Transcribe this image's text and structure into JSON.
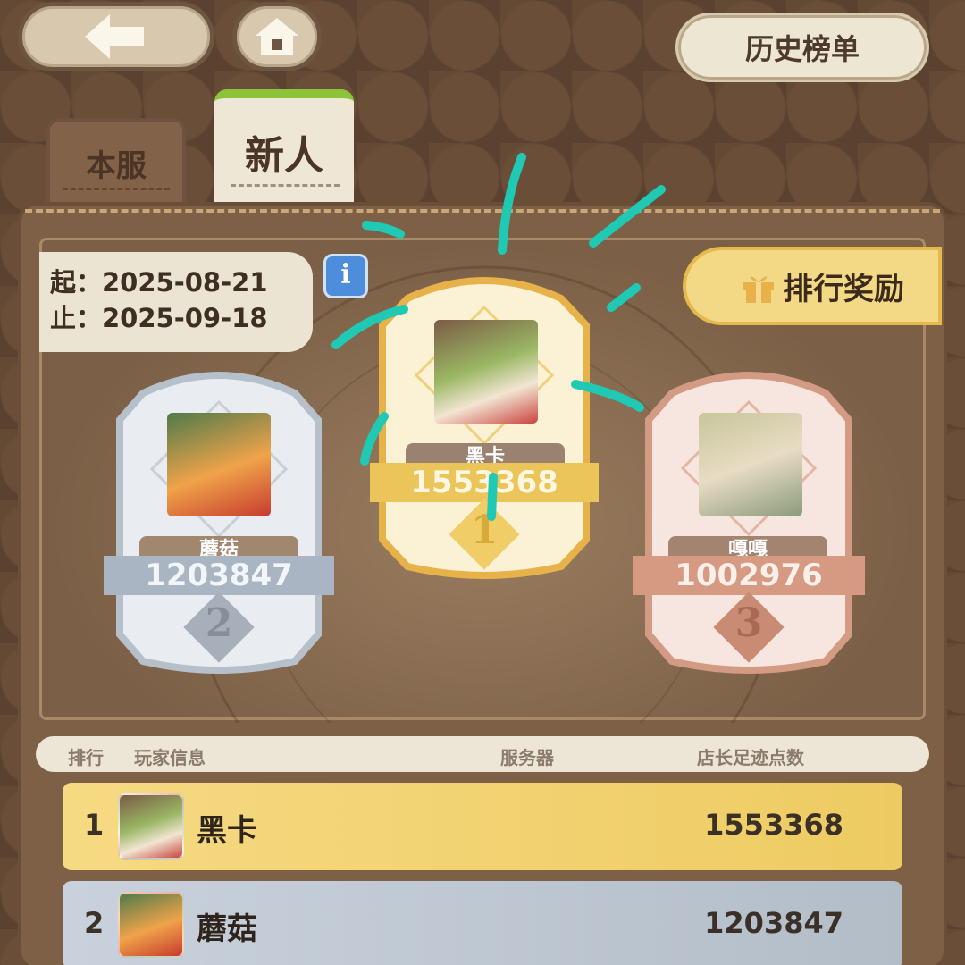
{
  "header": {
    "history_label": "历史榜单"
  },
  "tabs": [
    {
      "label": "本服",
      "active": false
    },
    {
      "label": "新人",
      "active": true
    }
  ],
  "period": {
    "start": "起：2025-08-21",
    "end": "止：2025-09-18"
  },
  "reward_label": "排行奖励",
  "podium": [
    {
      "rank": "1",
      "name": "黑卡",
      "score": "1553368"
    },
    {
      "rank": "2",
      "name": "蘑菇",
      "score": "1203847"
    },
    {
      "rank": "3",
      "name": "嘎嘎",
      "score": "1002976"
    }
  ],
  "table": {
    "columns": [
      "排行",
      "玩家信息",
      "服务器",
      "店长足迹点数"
    ],
    "rows": [
      {
        "rank": "1",
        "name": "黑卡",
        "score": "1553368"
      },
      {
        "rank": "2",
        "name": "蘑菇",
        "score": "1203847"
      }
    ]
  },
  "colors": {
    "gold": "#f1cf6b",
    "silver": "#bcc6d1",
    "bronze": "#d9a08a",
    "accent_green": "#8cc33a",
    "scribble": "#1fc9b4"
  },
  "icons": [
    "back-arrow-icon",
    "home-icon",
    "info-icon",
    "gift-icon"
  ]
}
